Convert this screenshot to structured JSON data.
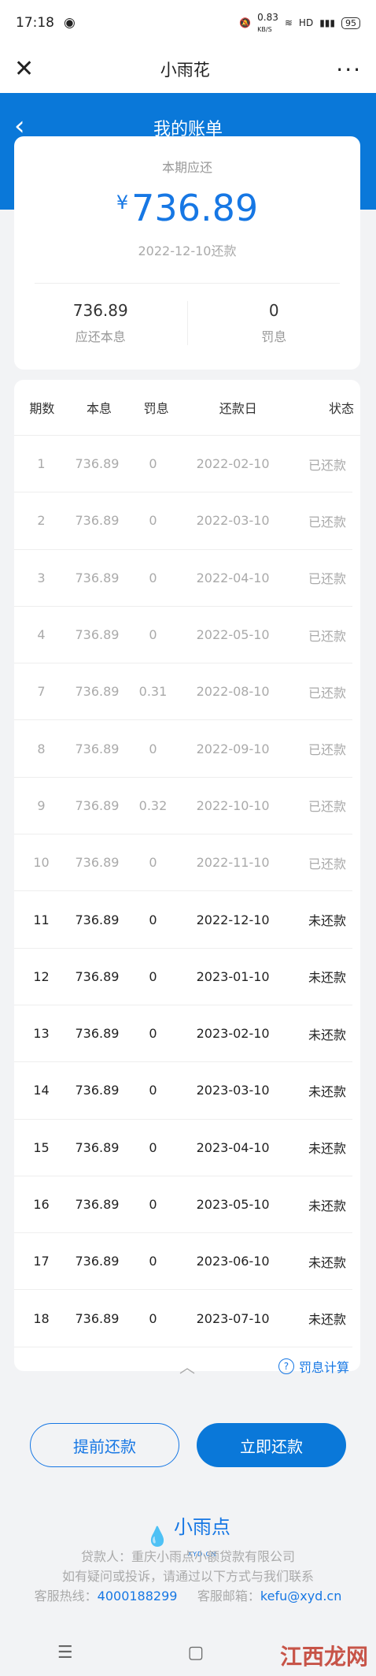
{
  "status": {
    "time": "17:18",
    "speed": "0.83",
    "speed_unit": "KB/S",
    "network": "HD",
    "battery": "95"
  },
  "topbar": {
    "title": "小雨花"
  },
  "header": {
    "title": "我的账单"
  },
  "summary": {
    "label": "本期应还",
    "currency": "¥",
    "amount": "736.89",
    "due_date": "2022-12-10还款",
    "principal_value": "736.89",
    "principal_label": "应还本息",
    "penalty_value": "0",
    "penalty_label": "罚息"
  },
  "table": {
    "headers": [
      "期数",
      "本息",
      "罚息",
      "还款日",
      "状态"
    ],
    "rows": [
      {
        "period": "1",
        "amount": "736.89",
        "penalty": "0",
        "date": "2022-02-10",
        "status": "已还款",
        "paid": true
      },
      {
        "period": "2",
        "amount": "736.89",
        "penalty": "0",
        "date": "2022-03-10",
        "status": "已还款",
        "paid": true
      },
      {
        "period": "3",
        "amount": "736.89",
        "penalty": "0",
        "date": "2022-04-10",
        "status": "已还款",
        "paid": true
      },
      {
        "period": "4",
        "amount": "736.89",
        "penalty": "0",
        "date": "2022-05-10",
        "status": "已还款",
        "paid": true
      },
      {
        "period": "7",
        "amount": "736.89",
        "penalty": "0.31",
        "date": "2022-08-10",
        "status": "已还款",
        "paid": true
      },
      {
        "period": "8",
        "amount": "736.89",
        "penalty": "0",
        "date": "2022-09-10",
        "status": "已还款",
        "paid": true
      },
      {
        "period": "9",
        "amount": "736.89",
        "penalty": "0.32",
        "date": "2022-10-10",
        "status": "已还款",
        "paid": true
      },
      {
        "period": "10",
        "amount": "736.89",
        "penalty": "0",
        "date": "2022-11-10",
        "status": "已还款",
        "paid": true
      },
      {
        "period": "11",
        "amount": "736.89",
        "penalty": "0",
        "date": "2022-12-10",
        "status": "未还款",
        "paid": false
      },
      {
        "period": "12",
        "amount": "736.89",
        "penalty": "0",
        "date": "2023-01-10",
        "status": "未还款",
        "paid": false
      },
      {
        "period": "13",
        "amount": "736.89",
        "penalty": "0",
        "date": "2023-02-10",
        "status": "未还款",
        "paid": false
      },
      {
        "period": "14",
        "amount": "736.89",
        "penalty": "0",
        "date": "2023-03-10",
        "status": "未还款",
        "paid": false
      },
      {
        "period": "15",
        "amount": "736.89",
        "penalty": "0",
        "date": "2023-04-10",
        "status": "未还款",
        "paid": false
      },
      {
        "period": "16",
        "amount": "736.89",
        "penalty": "0",
        "date": "2023-05-10",
        "status": "未还款",
        "paid": false
      },
      {
        "period": "17",
        "amount": "736.89",
        "penalty": "0",
        "date": "2023-06-10",
        "status": "未还款",
        "paid": false
      },
      {
        "period": "18",
        "amount": "736.89",
        "penalty": "0",
        "date": "2023-07-10",
        "status": "未还款",
        "paid": false
      }
    ],
    "calc_label": "罚息计算"
  },
  "buttons": {
    "early": "提前还款",
    "pay_now": "立即还款"
  },
  "brand": {
    "name": "小雨点",
    "sub": "XYD.CN"
  },
  "footer": {
    "lender": "贷款人：重庆小雨点小额贷款有限公司",
    "contact_note": "如有疑问或投诉，请通过以下方式与我们联系",
    "hotline_label": "客服热线：",
    "hotline": "4000188299",
    "email_label": "客服邮箱：",
    "email": "kefu@xyd.cn"
  },
  "watermark": "江西龙网",
  "colors": {
    "primary": "#0a78d9",
    "accent": "#1677e4"
  }
}
